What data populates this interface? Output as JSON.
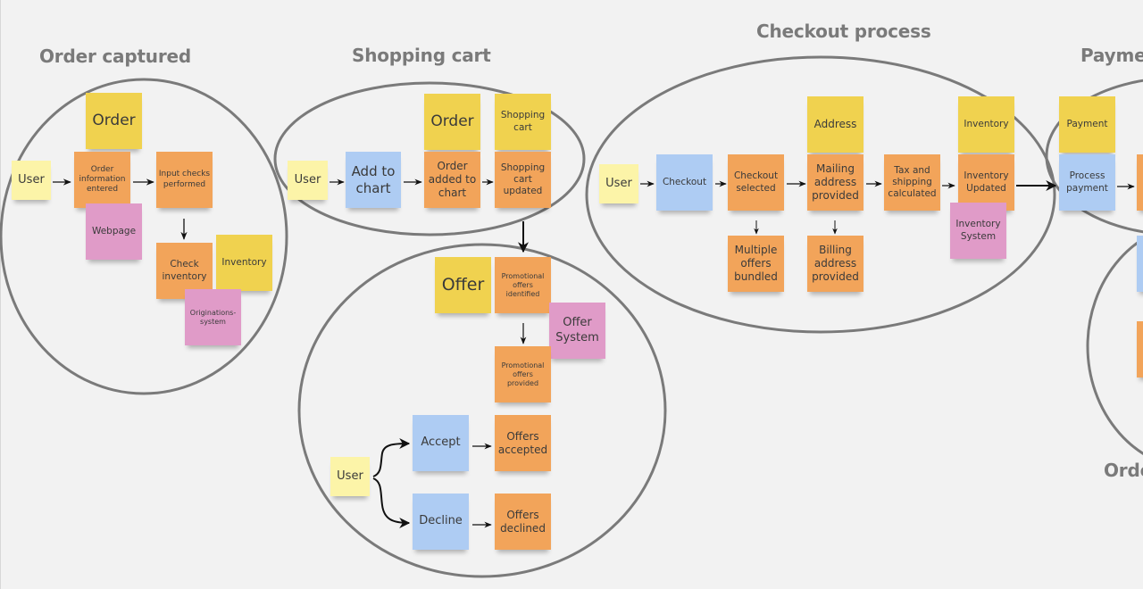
{
  "sections": {
    "order_captured": "Order captured",
    "shopping_cart": "Shopping cart",
    "checkout_process": "Checkout process",
    "payment": "Payme",
    "order_partial": "Orde"
  },
  "order_captured": {
    "order": "Order",
    "user": "User",
    "order_info": "Order information entered",
    "input_checks": "Input checks performed",
    "webpage": "Webpage",
    "check_inventory": "Check inventory",
    "inventory": "Inventory",
    "originations": "Originations-system"
  },
  "shopping_cart": {
    "user": "User",
    "add_to_chart": "Add to chart",
    "order": "Order",
    "order_added": "Order added to chart",
    "shopping_cart_entity": "Shopping cart",
    "cart_updated": "Shopping cart updated"
  },
  "offer": {
    "offer": "Offer",
    "promo_identified": "Promotional offers identified",
    "offer_system": "Offer System",
    "promo_provided": "Promotional offers provided",
    "user": "User",
    "accept": "Accept",
    "offers_accepted": "Offers accepted",
    "decline": "Decline",
    "offers_declined": "Offers declined"
  },
  "checkout": {
    "user": "User",
    "checkout": "Checkout",
    "checkout_selected": "Checkout selected",
    "address": "Address",
    "mailing_address": "Mailing address provided",
    "tax_shipping": "Tax and shipping calculated",
    "inventory": "Inventory",
    "inventory_updated": "Inventory Updated",
    "inventory_system": "Inventory System",
    "multiple_offers": "Multiple offers bundled",
    "billing_address": "Billing address provided"
  },
  "payment": {
    "payment": "Payment",
    "process_payment": "Process payment"
  },
  "colors": {
    "background": "#f2f2f2",
    "entity_yellow": "#f0d24f",
    "actor_yellow": "#fcf4a8",
    "event_orange": "#f2a45a",
    "command_blue": "#aeccf3",
    "system_pink": "#e09bc8",
    "boundary_gray": "#7a7a7a"
  }
}
